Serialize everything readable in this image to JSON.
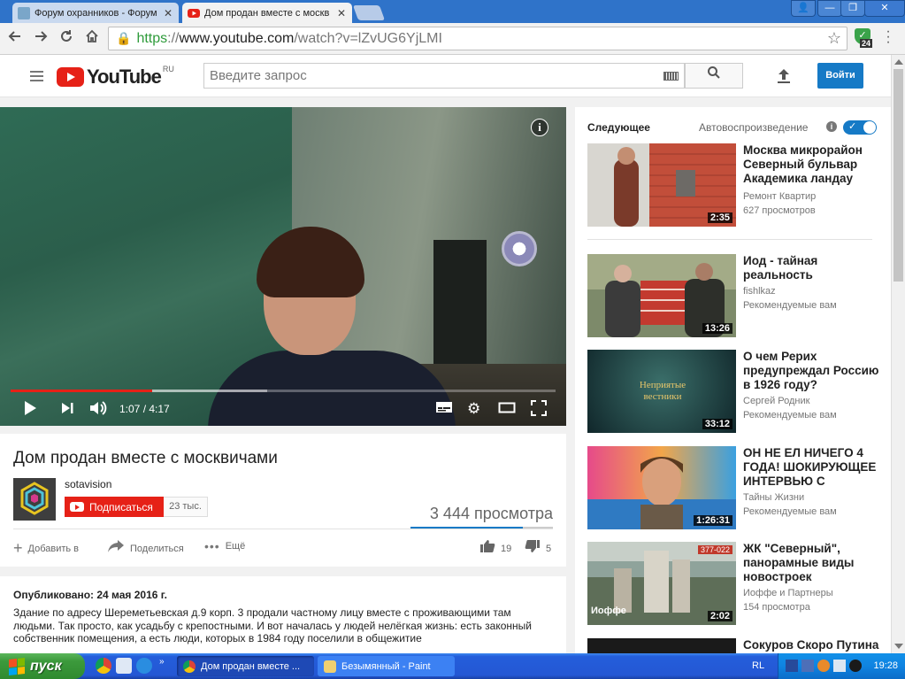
{
  "browser": {
    "tabs": [
      {
        "title": "Форум охранников - Форум",
        "active": false
      },
      {
        "title": "Дом продан вместе с москв",
        "active": true
      }
    ],
    "window_controls": [
      "👤",
      "—",
      "❐",
      "✕"
    ],
    "url": {
      "scheme": "https",
      "separator": "://",
      "host": "www.youtube.com",
      "path": "/watch?v=lZvUG6YjLMI"
    },
    "extension_badge": "24"
  },
  "youtube": {
    "logo_text": "YouTube",
    "logo_region": "RU",
    "search_placeholder": "Введите запрос",
    "signin_label": "Войти"
  },
  "player": {
    "current_time": "1:07",
    "duration": "4:17",
    "time_display": "1:07 / 4:17",
    "played_fraction": 0.26,
    "buffered_fraction": 0.47
  },
  "video": {
    "title": "Дом продан вместе с москвичами",
    "channel": "sotavision",
    "subscribe_label": "Подписаться",
    "subscriber_count": "23 тыс.",
    "views": "3 444 просмотра",
    "actions": {
      "add_to": "Добавить в",
      "share": "Поделиться",
      "more": "Ещё"
    },
    "likes": "19",
    "dislikes": "5",
    "like_ratio": 0.79
  },
  "description": {
    "published": "Опубликовано: 24 мая 2016 г.",
    "text": "Здание по адресу Шереметьевская д.9 корп. 3 продали частному лицу вместе с проживающими там людьми. Так просто, как усадьбу с крепостными. И вот началась у людей нелёгкая жизнь: есть законный собственник помещения, а есть люди, которых в 1984 году поселили в общежитие"
  },
  "sidebar": {
    "up_next_label": "Следующее",
    "autoplay_label": "Автовоспроизведение",
    "autoplay_on": true,
    "items": [
      {
        "title": "Москва микрорайон Северный бульвар Академика ландау",
        "channel": "Ремонт Квартир",
        "meta": "627 просмотров",
        "duration": "2:35"
      },
      {
        "title": "Иод - тайная реальность",
        "channel": "fishlkaz",
        "meta": "Рекомендуемые вам",
        "duration": "13:26"
      },
      {
        "title": "О чем Рерих предупреждал Россию в 1926 году?",
        "channel": "Сергей Родник",
        "meta": "Рекомендуемые вам",
        "duration": "33:12",
        "thumb_text": "Неприятые вестники"
      },
      {
        "title": "ОН НЕ ЕЛ НИЧЕГО 4 ГОДА! ШОКИРУЮЩЕЕ ИНТЕРВЬЮ С",
        "channel": "Тайны Жизни",
        "meta": "Рекомендуемые вам",
        "duration": "1:26:31"
      },
      {
        "title": "ЖК \"Северный\", панорамные виды новостроек",
        "channel": "Иоффе и Партнеры",
        "meta": "154 просмотра",
        "duration": "2:02",
        "thumb_text": "Иоффе",
        "thumb_label": "377-022"
      },
      {
        "title": "Сокуров Скоро Путина",
        "channel": "",
        "meta": "",
        "duration": ""
      }
    ]
  },
  "taskbar": {
    "start_label": "пуск",
    "buttons": [
      {
        "label": "Дом продан вместе ...",
        "active": true
      },
      {
        "label": "Безымянный - Paint",
        "active": false
      }
    ],
    "language": "RL",
    "clock": "19:28"
  },
  "colors": {
    "youtube_red": "#e62117",
    "youtube_blue": "#167ac6",
    "chrome_frame": "#2f73c9",
    "xp_taskbar": "#245edb",
    "xp_start": "#3c9a3c"
  }
}
